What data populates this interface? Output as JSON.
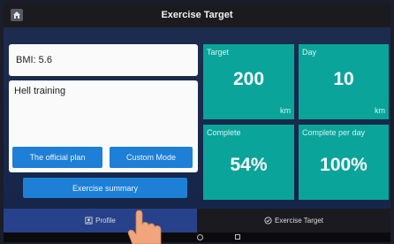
{
  "header": {
    "title": "Exercise Target",
    "home_icon": "home-icon"
  },
  "profile": {
    "bmi_label": "BMI: 5.6",
    "plan_text": "Hell training",
    "official_plan_label": "The official plan",
    "custom_mode_label": "Custom Mode",
    "summary_label": "Exercise summary"
  },
  "stats": {
    "target": {
      "label": "Target",
      "value": "200",
      "unit": "km"
    },
    "day": {
      "label": "Day",
      "value": "10",
      "unit": "km"
    },
    "complete": {
      "label": "Complete",
      "value": "54%"
    },
    "complete_per_day": {
      "label": "Complete per day",
      "value": "100%"
    }
  },
  "nav": {
    "profile_label": "Profile",
    "target_label": "Exercise Target",
    "active": "Profile"
  },
  "colors": {
    "tile": "#0aa49a",
    "button": "#1e7fd6",
    "nav_active": "#27428a",
    "background": "#16264a"
  }
}
